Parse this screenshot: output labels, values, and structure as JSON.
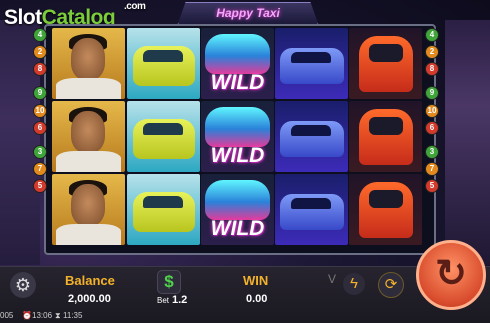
{
  "watermark": {
    "brand_a": "Slot",
    "brand_b": "Catalog",
    "domain": ".com"
  },
  "game": {
    "logo_text": "Happy Taxi"
  },
  "paylines": {
    "left": [
      "4",
      "2",
      "8",
      "9",
      "10",
      "6",
      "3",
      "7",
      "5"
    ],
    "right": [
      "4",
      "2",
      "8",
      "9",
      "10",
      "6",
      "3",
      "7",
      "5"
    ],
    "colors": {
      "green": "#3fa43a",
      "orange": "#e38a1f",
      "red": "#d33a2b"
    }
  },
  "reels": [
    [
      "man",
      "man",
      "man"
    ],
    [
      "yellow-taxi",
      "yellow-taxi",
      "yellow-taxi"
    ],
    [
      "wild",
      "wild",
      "wild"
    ],
    [
      "blue-taxi",
      "blue-taxi",
      "blue-taxi"
    ],
    [
      "tuk-tuk",
      "tuk-tuk",
      "tuk-tuk"
    ]
  ],
  "wild_label": "WILD",
  "controls": {
    "balance_label": "Balance",
    "balance_value": "2,000.00",
    "bet_label": "Bet",
    "bet_value": "1.2",
    "win_label": "WIN",
    "win_value": "0.00",
    "settings_icon": "gear-icon",
    "bet_icon": "dollar-icon",
    "turbo_icon": "lightning-icon",
    "auto_icon": "autoplay-icon",
    "spin_icon": "spin-icon",
    "v_glyph": "V"
  },
  "status": {
    "left_code": "005",
    "clock1": "13:06",
    "clock2": "11:35"
  },
  "accent": "#f3b22a"
}
